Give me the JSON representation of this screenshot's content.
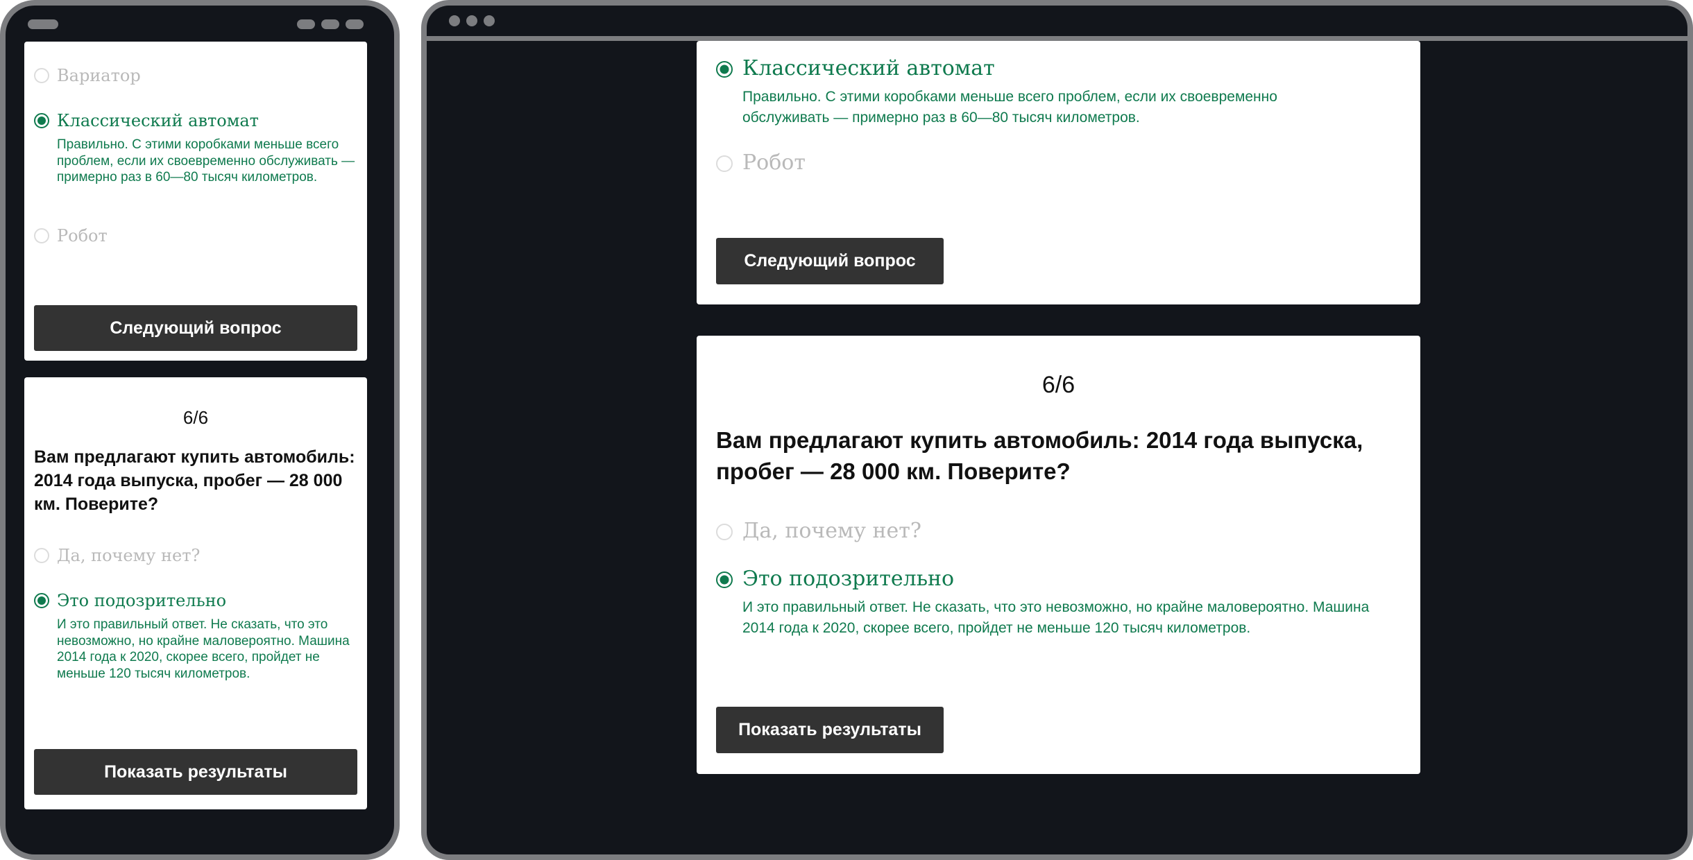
{
  "quiz": {
    "prev_question": {
      "options": [
        {
          "label": "Вариатор",
          "state": "unselected"
        },
        {
          "label": "Классический автомат",
          "state": "correct"
        },
        {
          "label": "Робот",
          "state": "unselected"
        }
      ],
      "explanation": "Правильно. С этими коробками меньше всего проблем, если их своевременно обслуживать — примерно раз в 60—80 тысяч километров.",
      "button_label": "Следующий вопрос"
    },
    "current_question": {
      "counter": "6/6",
      "text": "Вам предлагают купить автомобиль: 2014 года выпуска, пробег — 28 000 км. Поверите?",
      "options": [
        {
          "label": "Да, почему нет?",
          "state": "unselected"
        },
        {
          "label": "Это подозрительно",
          "state": "correct"
        }
      ],
      "explanation": "И это правильный ответ. Не сказать, что это невозможно, но крайне маловероятно. Машина 2014 года к 2020, скорее всего, пройдет не меньше 120 тысяч километров.",
      "button_label": "Показать результаты"
    }
  },
  "colors": {
    "correct": "#0f7a4e",
    "muted_text": "#b9b9b9",
    "button_bg": "#333333",
    "screen_bg": "#12151b",
    "device_frame": "#7c7d80"
  }
}
